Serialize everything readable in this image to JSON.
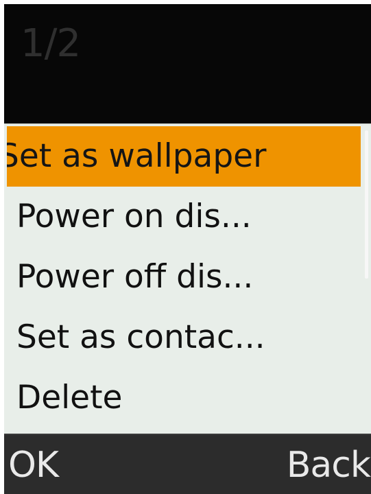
{
  "header": {
    "page_indicator": "1/2"
  },
  "menu": {
    "items": [
      {
        "label": "Set as wallpaper",
        "selected": true
      },
      {
        "label": "Power on dis...",
        "selected": false
      },
      {
        "label": "Power off dis...",
        "selected": false
      },
      {
        "label": "Set as contac...",
        "selected": false
      },
      {
        "label": "Delete",
        "selected": false
      }
    ]
  },
  "softkeys": {
    "left_label": "OK",
    "right_label": "Back"
  },
  "colors": {
    "header_background": "#070707",
    "menu_background": "#e8eee9",
    "selected_item_background": "#ef9300",
    "softkey_background": "#2c2c2c",
    "softkey_text": "#e9e9e9"
  }
}
